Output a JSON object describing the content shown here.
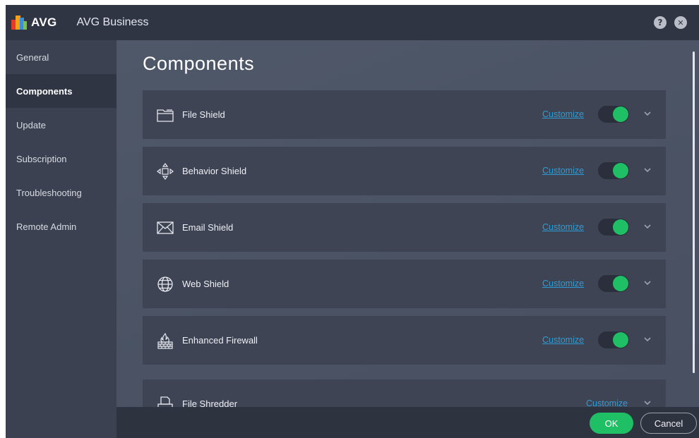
{
  "titlebar": {
    "logo_text": "AVG",
    "app_title": "AVG Business",
    "help_label": "?",
    "close_label": "✕"
  },
  "sidebar": {
    "items": [
      {
        "label": "General"
      },
      {
        "label": "Components",
        "active": true
      },
      {
        "label": "Update"
      },
      {
        "label": "Subscription"
      },
      {
        "label": "Troubleshooting"
      },
      {
        "label": "Remote Admin"
      }
    ]
  },
  "main": {
    "title": "Components",
    "components": [
      {
        "name": "File Shield",
        "icon": "folder-icon",
        "customize": "Customize",
        "enabled": true
      },
      {
        "name": "Behavior Shield",
        "icon": "move-arrows-icon",
        "customize": "Customize",
        "enabled": true
      },
      {
        "name": "Email Shield",
        "icon": "envelope-icon",
        "customize": "Customize",
        "enabled": true
      },
      {
        "name": "Web Shield",
        "icon": "globe-icon",
        "customize": "Customize",
        "enabled": true
      },
      {
        "name": "Enhanced Firewall",
        "icon": "firewall-icon",
        "customize": "Customize",
        "enabled": true
      },
      {
        "name": "File Shredder",
        "icon": "shredder-icon",
        "customize": "Customize"
      }
    ]
  },
  "footer": {
    "ok_label": "OK",
    "cancel_label": "Cancel"
  },
  "colors": {
    "accent_green": "#1fbf66",
    "link_blue": "#2f9bd4",
    "titlebar": "#303544",
    "sidebar": "#3b4150",
    "card": "#3e4454"
  }
}
